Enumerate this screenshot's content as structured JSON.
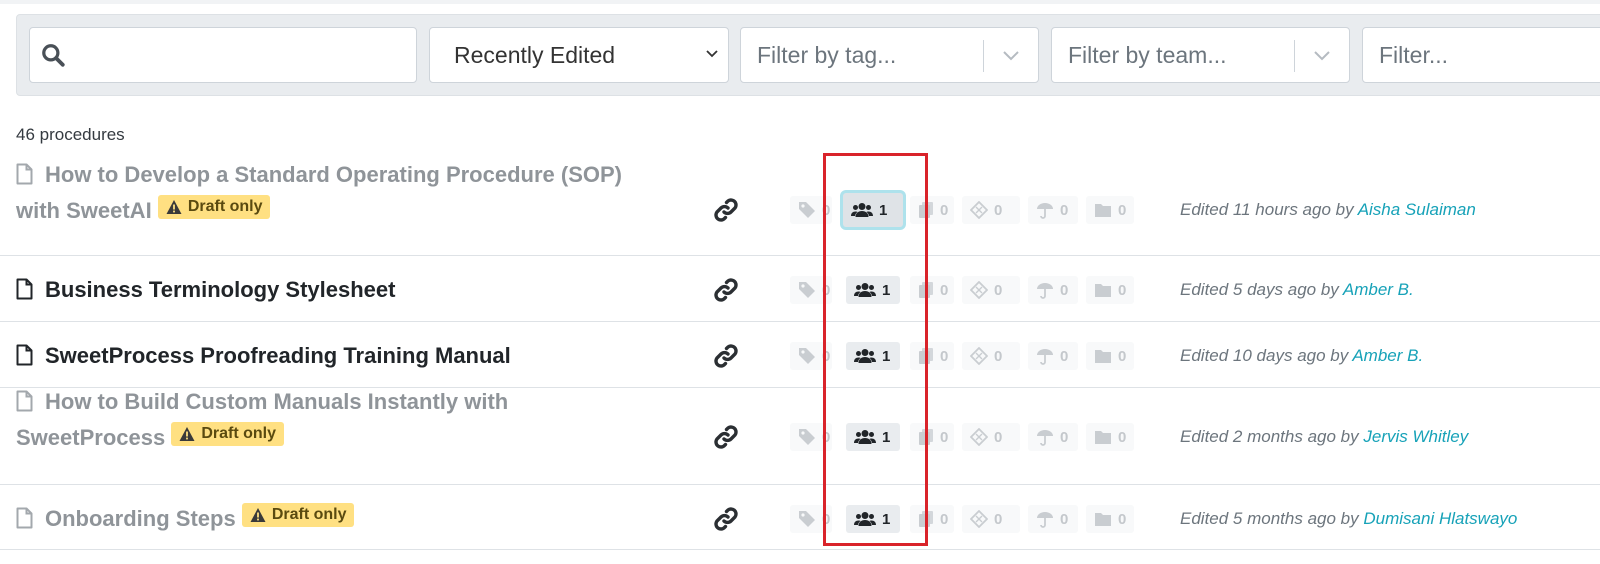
{
  "filters": {
    "search_placeholder": "",
    "sort_value": "Recently Edited",
    "tag_placeholder": "Filter by tag...",
    "team_placeholder": "Filter by team...",
    "other_placeholder": "Filter..."
  },
  "count_label": "46 procedures",
  "draft_badge": "Draft only",
  "colors": {
    "draft_badge_bg": "#ffe082",
    "author_link": "#17a2b8",
    "highlight_box": "#d9232a"
  },
  "procedures": [
    {
      "title_line1": "How to Develop a Standard Operating Procedure (SOP)",
      "title_line2": "with SweetAI",
      "draft": true,
      "counts": {
        "tags": "0",
        "teams": "1",
        "copies": "0",
        "policies": "0",
        "umbrella": "0",
        "folders": "0"
      },
      "edited_prefix": "Edited 11 hours ago by",
      "edited_by": "Aisha Sulaiman"
    },
    {
      "title_line1": "Business Terminology Stylesheet",
      "title_line2": "",
      "draft": false,
      "counts": {
        "tags": "0",
        "teams": "1",
        "copies": "0",
        "policies": "0",
        "umbrella": "0",
        "folders": "0"
      },
      "edited_prefix": "Edited 5 days ago by",
      "edited_by": "Amber B."
    },
    {
      "title_line1": "SweetProcess Proofreading Training Manual",
      "title_line2": "",
      "draft": false,
      "counts": {
        "tags": "0",
        "teams": "1",
        "copies": "0",
        "policies": "0",
        "umbrella": "0",
        "folders": "0"
      },
      "edited_prefix": "Edited 10 days ago by",
      "edited_by": "Amber B."
    },
    {
      "title_line1": "How to Build Custom Manuals Instantly with",
      "title_line2": "SweetProcess",
      "draft": true,
      "counts": {
        "tags": "0",
        "teams": "1",
        "copies": "0",
        "policies": "0",
        "umbrella": "0",
        "folders": "0"
      },
      "edited_prefix": "Edited 2 months ago by",
      "edited_by": "Jervis Whitley"
    },
    {
      "title_line1": "Onboarding Steps",
      "title_line2": "",
      "draft": true,
      "counts": {
        "tags": "0",
        "teams": "1",
        "copies": "0",
        "policies": "0",
        "umbrella": "0",
        "folders": "0"
      },
      "edited_prefix": "Edited 5 months ago by",
      "edited_by": "Dumisani Hlatswayo"
    }
  ]
}
